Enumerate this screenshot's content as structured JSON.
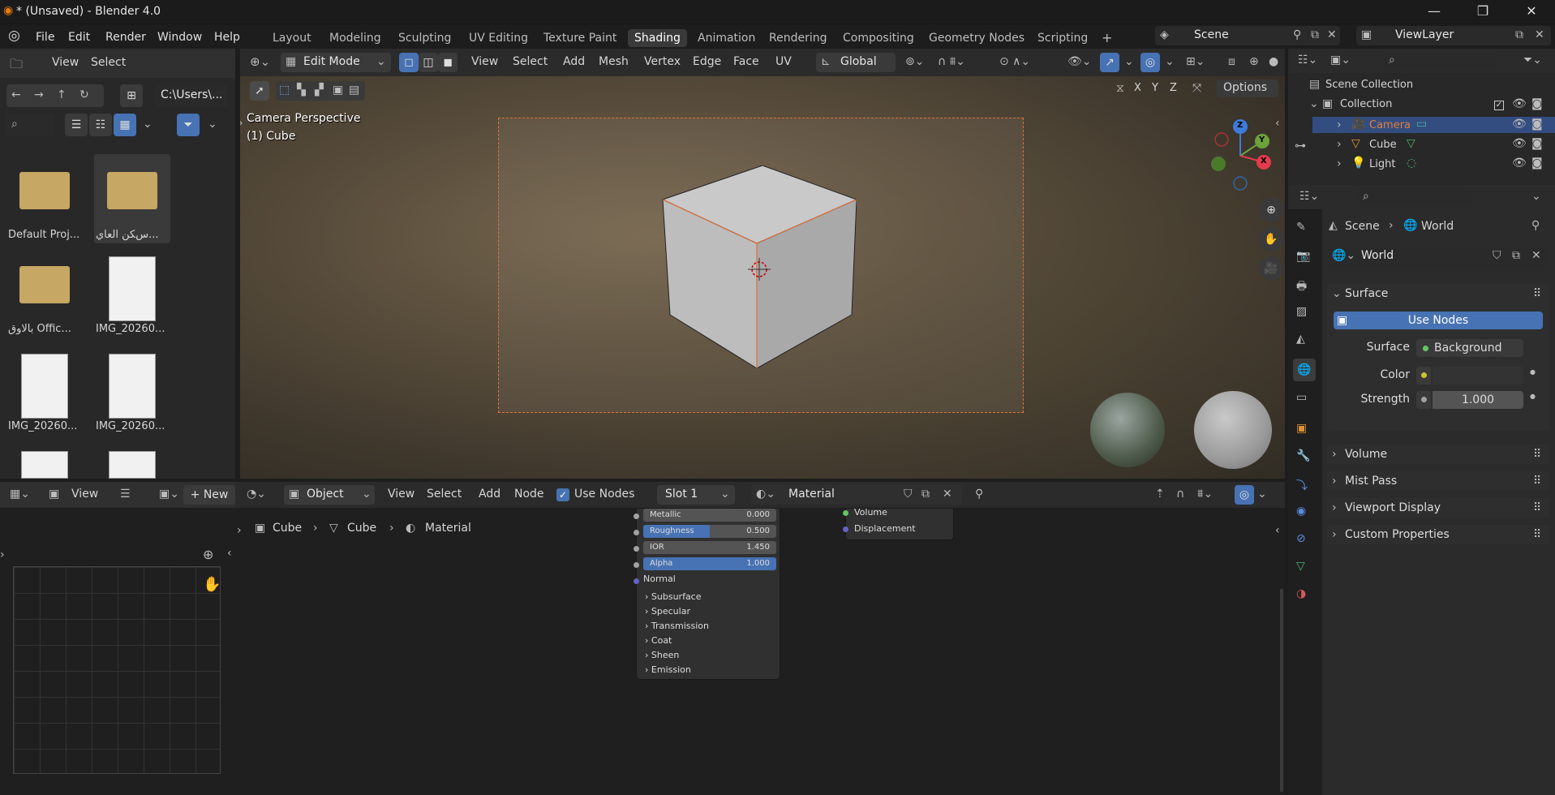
{
  "window": {
    "title": "* (Unsaved) - Blender 4.0",
    "min": "—",
    "max": "❐",
    "close": "✕"
  },
  "menu": [
    "File",
    "Edit",
    "Render",
    "Window",
    "Help"
  ],
  "workspaces": [
    "Layout",
    "Modeling",
    "Sculpting",
    "UV Editing",
    "Texture Paint",
    "Shading",
    "Animation",
    "Rendering",
    "Compositing",
    "Geometry Nodes",
    "Scripting",
    "+"
  ],
  "scene": {
    "label": "Scene",
    "viewlayer": "ViewLayer"
  },
  "filebrowser": {
    "view": "View",
    "select": "Select",
    "path": "C:\\Users\\...",
    "items": [
      {
        "name": "Default Proj...",
        "type": "folder"
      },
      {
        "name": "ﺱﻜﻦ ﺍﻟﻌﺎﻱ...",
        "type": "folder"
      },
      {
        "name": "ﺑﺎﻻﻭﻕ Offic...",
        "type": "folder"
      },
      {
        "name": "IMG_20260...",
        "type": "image"
      },
      {
        "name": "IMG_20260...",
        "type": "image"
      },
      {
        "name": "IMG_20260...",
        "type": "image"
      }
    ]
  },
  "viewport_header": {
    "mode": "Edit Mode",
    "menus": [
      "View",
      "Select",
      "Add",
      "Mesh",
      "Vertex",
      "Edge",
      "Face",
      "UV"
    ],
    "transform": "Global",
    "axes": [
      "X",
      "Y",
      "Z"
    ],
    "options": "Options"
  },
  "viewport": {
    "line1": "Camera Perspective",
    "line2": "(1) Cube",
    "gizmo": {
      "z": "Z",
      "y": "Y",
      "x": "X"
    }
  },
  "image_editor": {
    "view": "View",
    "new": "New"
  },
  "node_header": {
    "type": "Object",
    "menus": [
      "View",
      "Select",
      "Add",
      "Node"
    ],
    "use_nodes": "Use Nodes",
    "slot": "Slot 1",
    "material": "Material"
  },
  "breadcrumb": [
    "Cube",
    "Cube",
    "Material"
  ],
  "bsdf": {
    "metallic": {
      "label": "Metallic",
      "value": "0.000"
    },
    "roughness": {
      "label": "Roughness",
      "value": "0.500"
    },
    "ior": {
      "label": "IOR",
      "value": "1.450"
    },
    "alpha": {
      "label": "Alpha",
      "value": "1.000"
    },
    "normal": "Normal",
    "panels": [
      "Subsurface",
      "Specular",
      "Transmission",
      "Coat",
      "Sheen",
      "Emission"
    ]
  },
  "output_node": {
    "volume": "Volume",
    "displacement": "Displacement"
  },
  "outliner": {
    "root": "Scene Collection",
    "collection": "Collection",
    "items": [
      {
        "name": "Camera",
        "selected": true
      },
      {
        "name": "Cube",
        "selected": false
      },
      {
        "name": "Light",
        "selected": false
      }
    ]
  },
  "properties": {
    "breadcrumb": [
      "Scene",
      "World"
    ],
    "world": "World",
    "surface_header": "Surface",
    "use_nodes": "Use Nodes",
    "surface_label": "Surface",
    "surface_value": "Background",
    "color_label": "Color",
    "strength_label": "Strength",
    "strength_value": "1.000",
    "sections": [
      "Volume",
      "Mist Pass",
      "Viewport Display",
      "Custom Properties"
    ]
  },
  "colors": {
    "accent": "#4772b3",
    "camera_orange": "#e0703a",
    "axis_x": "#e23c4c",
    "axis_y": "#6ba23c",
    "axis_z": "#3d7cdb"
  }
}
